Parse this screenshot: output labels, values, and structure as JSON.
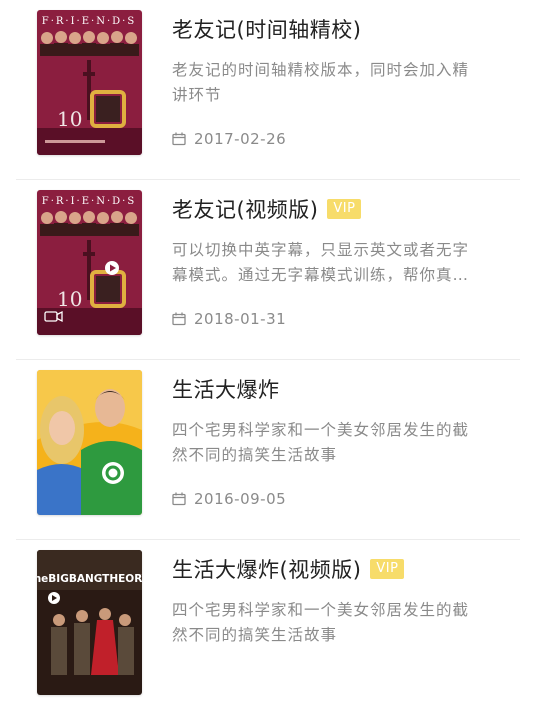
{
  "items": [
    {
      "title": "老友记(时间轴精校)",
      "vip": "",
      "description": "老友记的时间轴精校版本，同时会加入精讲环节",
      "date": "2017-02-26",
      "cover": {
        "logo": "F·R·I·E·N·D·S",
        "season": "10",
        "icon": "calendar-icon"
      }
    },
    {
      "title": "老友记(视频版)",
      "vip": "VIP",
      "description": "可以切换中英字幕，只显示英文或者无字幕模式。通过无字幕模式训练，帮你真正…",
      "date": "2018-01-31",
      "cover": {
        "logo": "F·R·I·E·N·D·S",
        "season": "10",
        "icon": "calendar-icon"
      }
    },
    {
      "title": "生活大爆炸",
      "vip": "",
      "description": "四个宅男科学家和一个美女邻居发生的截然不同的搞笑生活故事",
      "date": "2016-09-05",
      "cover": {
        "icon": "calendar-icon"
      }
    },
    {
      "title": "生活大爆炸(视频版)",
      "vip": "VIP",
      "description": "四个宅男科学家和一个美女邻居发生的截然不同的搞笑生活故事",
      "date": "",
      "cover": {
        "logo": "theBIGBANGTHEORY"
      }
    }
  ],
  "colors": {
    "title": "#222222",
    "secondary": "#8a8a8a",
    "vip_bg": "#f7dc6a",
    "friends_cover": "#8b1e3f"
  }
}
